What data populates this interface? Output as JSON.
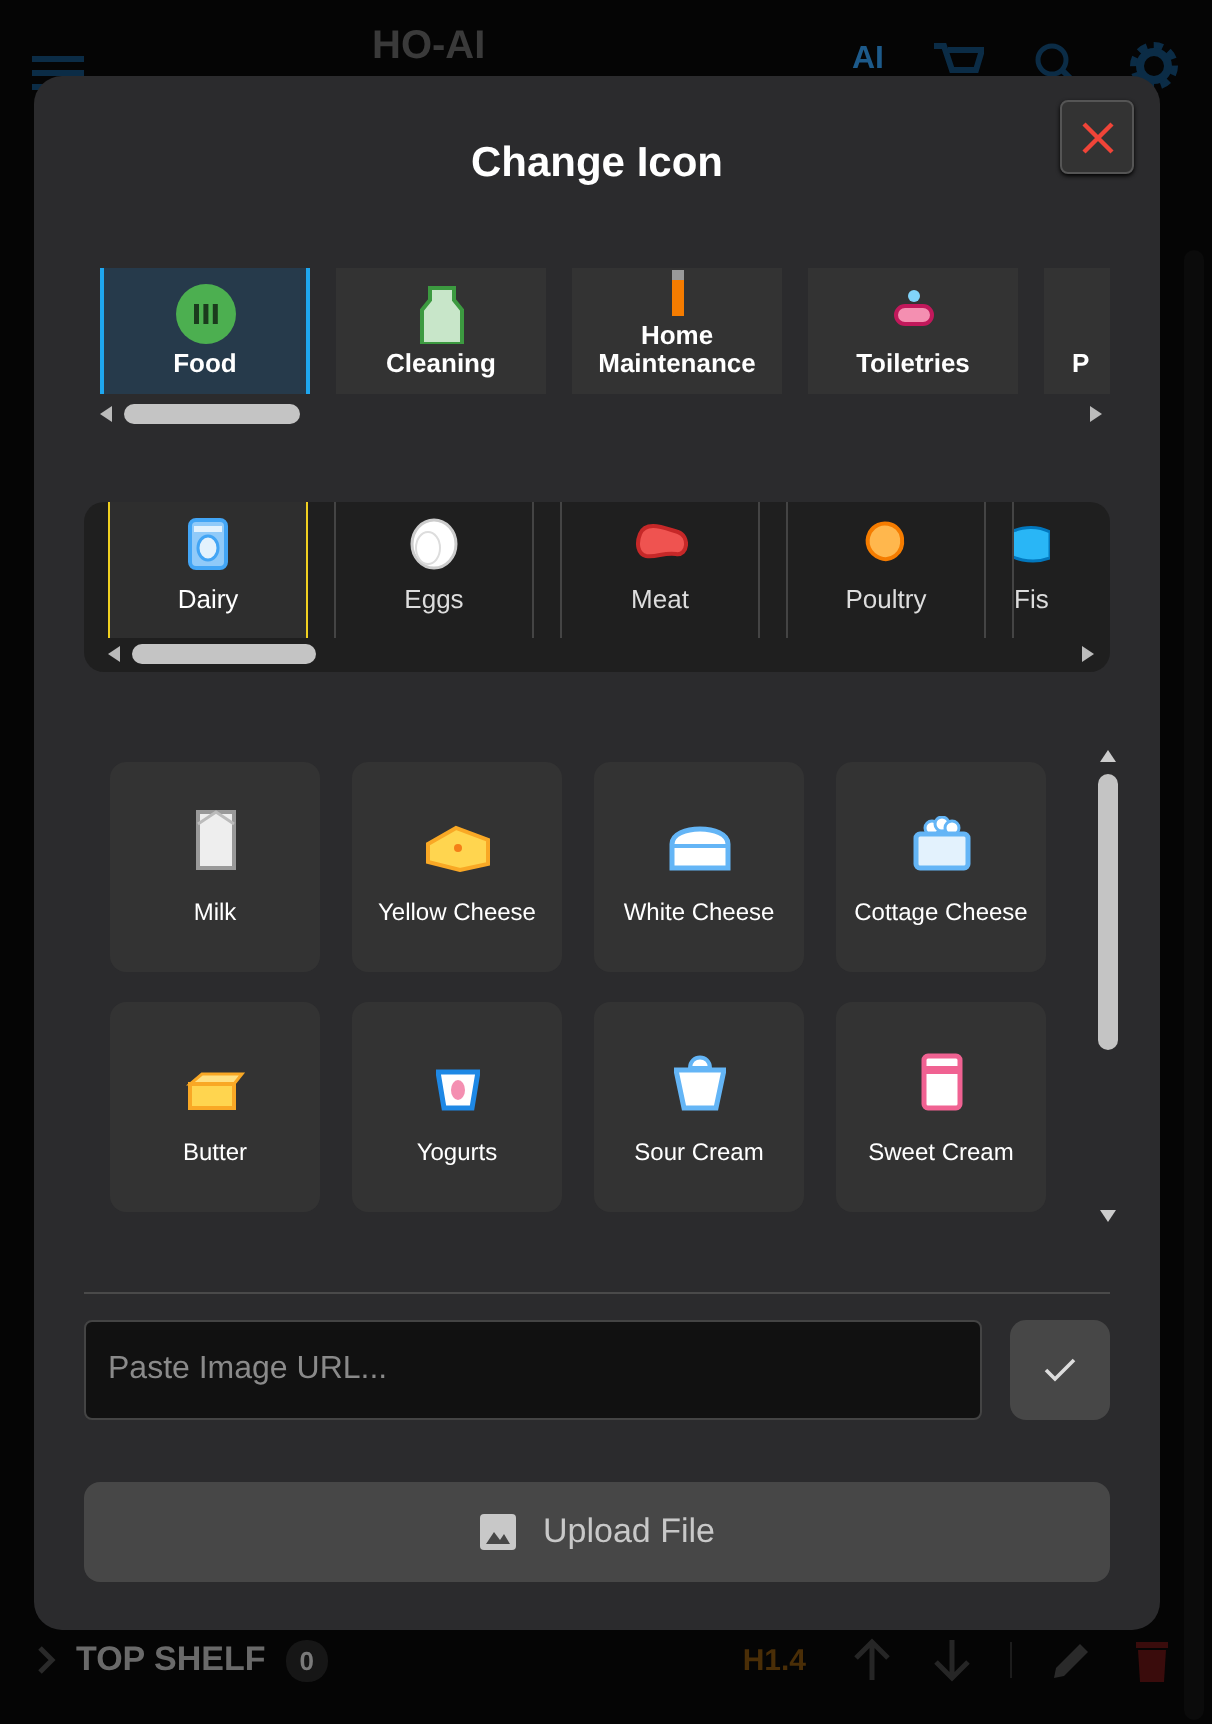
{
  "app_bar": {
    "title": "HO-AI",
    "ai_label": "AI"
  },
  "modal": {
    "title": "Change Icon",
    "categories": [
      {
        "label": "Food",
        "selected": true
      },
      {
        "label": "Cleaning",
        "selected": false
      },
      {
        "label": "Home Maintenance",
        "selected": false
      },
      {
        "label": "Toiletries",
        "selected": false
      },
      {
        "label": "P",
        "selected": false
      }
    ],
    "subcategories": [
      {
        "label": "Dairy",
        "selected": true
      },
      {
        "label": "Eggs",
        "selected": false
      },
      {
        "label": "Meat",
        "selected": false
      },
      {
        "label": "Poultry",
        "selected": false
      },
      {
        "label": "Fis",
        "selected": false
      }
    ],
    "icons": [
      {
        "label": "Milk"
      },
      {
        "label": "Yellow Cheese"
      },
      {
        "label": "White Cheese"
      },
      {
        "label": "Cottage Cheese"
      },
      {
        "label": "Butter"
      },
      {
        "label": "Yogurts"
      },
      {
        "label": "Sour Cream"
      },
      {
        "label": "Sweet Cream"
      }
    ],
    "url_field": {
      "placeholder": "Paste Image URL..."
    },
    "upload_button": {
      "label": "Upload File"
    }
  },
  "shelf_row": {
    "title": "TOP SHELF",
    "count": "0",
    "code": "H1.4"
  }
}
